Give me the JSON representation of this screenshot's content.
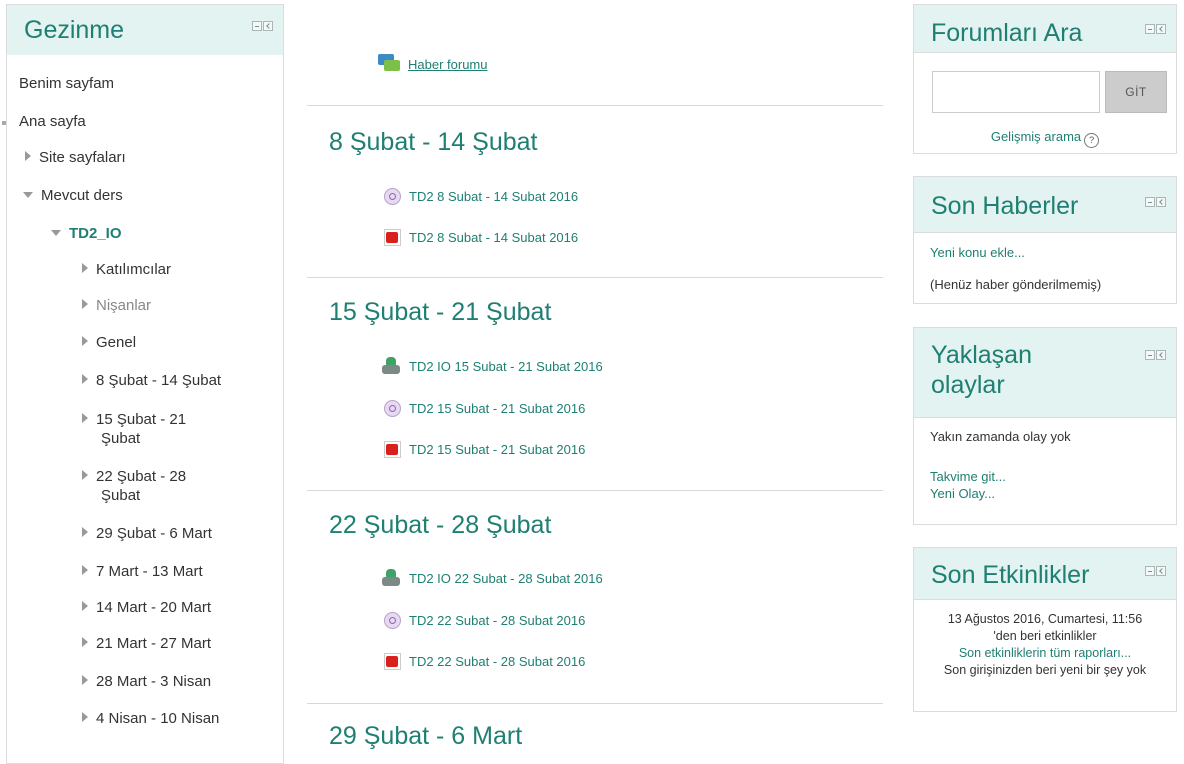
{
  "nav": {
    "title": "Gezinme",
    "items": [
      {
        "label": "Benim sayfam"
      },
      {
        "label": "Ana sayfa"
      },
      {
        "label": "Site sayfaları"
      },
      {
        "label": "Mevcut ders"
      },
      {
        "label": "TD2_IO"
      },
      {
        "label": "Katılımcılar"
      },
      {
        "label": "Nişanlar"
      },
      {
        "label": "Genel"
      },
      {
        "label": "8 Şubat - 14 Şubat"
      },
      {
        "label_line1": "15 Şubat - 21",
        "label_line2": "Şubat"
      },
      {
        "label_line1": "22 Şubat - 28",
        "label_line2": "Şubat"
      },
      {
        "label": "29 Şubat - 6 Mart"
      },
      {
        "label": "7 Mart - 13 Mart"
      },
      {
        "label": "14 Mart - 20 Mart"
      },
      {
        "label": "21 Mart - 27 Mart"
      },
      {
        "label": "28 Mart - 3 Nisan"
      },
      {
        "label": "4 Nisan - 10 Nisan"
      }
    ]
  },
  "course": {
    "forum_link": "Haber forumu",
    "sections": [
      {
        "title": "8 Şubat - 14 Şubat",
        "activities": [
          "TD2 8 Subat - 14 Subat 2016",
          "TD2 8 Subat - 14 Subat 2016"
        ]
      },
      {
        "title": "15 Şubat - 21 Şubat",
        "activities": [
          "TD2 IO 15 Subat - 21 Subat 2016",
          "TD2 15 Subat - 21 Subat 2016",
          "TD2 15 Subat - 21 Subat 2016"
        ]
      },
      {
        "title": "22 Şubat - 28 Şubat",
        "activities": [
          "TD2 IO 22 Subat - 28 Subat 2016",
          "TD2 22 Subat - 28 Subat 2016",
          "TD2 22 Subat - 28 Subat 2016"
        ]
      },
      {
        "title": "29 Şubat - 6 Mart"
      }
    ]
  },
  "search_block": {
    "title": "Forumları Ara",
    "button": "GİT",
    "advanced": "Gelişmiş arama",
    "help": "?"
  },
  "news_block": {
    "title": "Son Haberler",
    "add_link": "Yeni konu ekle...",
    "empty": "(Henüz haber gönderilmemiş)"
  },
  "events_block": {
    "title_line1": "Yaklaşan",
    "title_line2": "olaylar",
    "empty": "Yakın zamanda olay yok",
    "calendar_link": "Takvime git...",
    "new_event_link": "Yeni Olay..."
  },
  "recent_block": {
    "title": "Son Etkinlikler",
    "since_line1": "13 Ağustos 2016, Cumartesi, 11:56",
    "since_line2": "'den beri etkinlikler",
    "full_report": "Son etkinliklerin tüm raporları...",
    "nothing_new": "Son girişinizden beri yeni bir şey yok"
  },
  "colors": {
    "accent": "#1f7f72",
    "header_bg": "#e2f3f1"
  }
}
